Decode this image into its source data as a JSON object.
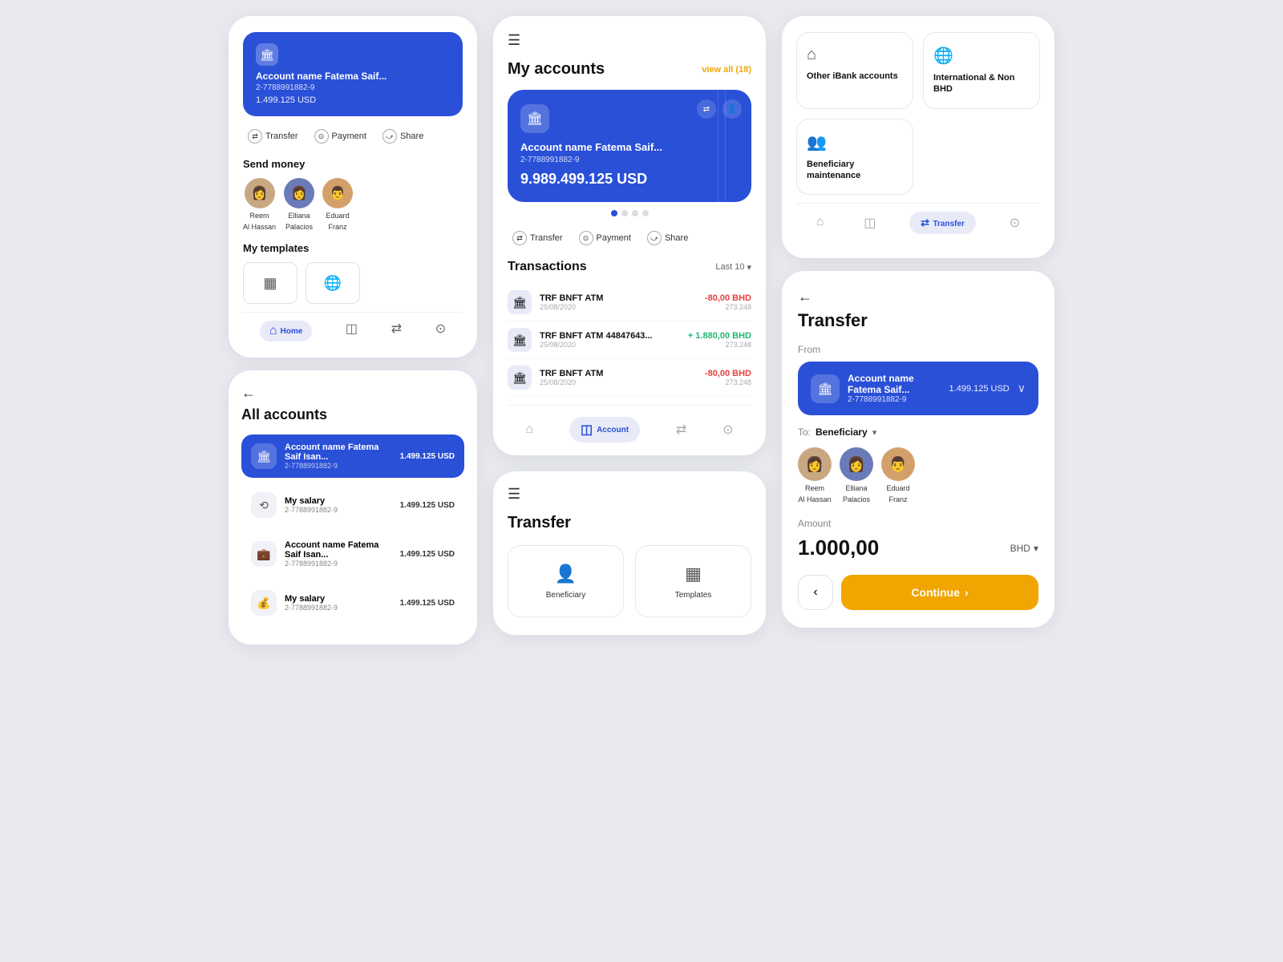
{
  "col1": {
    "top_card": {
      "account_name": "Account name Fatema Saif...",
      "account_number": "2-7788991882-9",
      "balance": "1.499.125 USD"
    },
    "actions": [
      {
        "label": "Transfer",
        "icon": "⇄"
      },
      {
        "label": "Payment",
        "icon": "⊙"
      },
      {
        "label": "Share",
        "icon": "⤻"
      }
    ],
    "send_money_title": "Send money",
    "contacts": [
      {
        "name": "Reem Al Hassan",
        "emoji": "👩"
      },
      {
        "name": "Elliana Palacios",
        "emoji": "👩"
      },
      {
        "name": "Eduard Franz",
        "emoji": "👨"
      }
    ],
    "templates_title": "My templates",
    "templates": [
      "▦",
      "🌐"
    ],
    "nav": [
      {
        "label": "Home",
        "icon": "⌂",
        "active": true
      },
      {
        "label": "",
        "icon": "◫",
        "active": false
      },
      {
        "label": "",
        "icon": "⇄",
        "active": false
      },
      {
        "label": "",
        "icon": "⊙",
        "active": false
      }
    ]
  },
  "col1_bottom": {
    "back_label": "←",
    "title": "All accounts",
    "accounts": [
      {
        "name": "Account name Fatema Saif Isan...",
        "number": "2-7788991882-9",
        "balance": "1.499.125 USD",
        "icon": "🏛",
        "highlighted": true
      },
      {
        "name": "My salary",
        "number": "2-7788991882-9",
        "balance": "1.499.125 USD",
        "icon": "⟲",
        "highlighted": false
      },
      {
        "name": "Account name Fatema Saif Isan...",
        "number": "2-7788991882-9",
        "balance": "1.499.125 USD",
        "icon": "💼",
        "highlighted": false
      },
      {
        "name": "My salary",
        "number": "2-7788991882-9",
        "balance": "1.499.125 USD",
        "icon": "💰",
        "highlighted": false
      }
    ]
  },
  "col2_main": {
    "menu_icon": "☰",
    "title": "My accounts",
    "view_all": "view all (18)",
    "account": {
      "name": "Account name Fatema Saif...",
      "number": "2-7788991882-9",
      "balance": "9.989.499.125 USD"
    },
    "dots": [
      true,
      false,
      false,
      false
    ],
    "action_buttons": [
      {
        "label": "Transfer",
        "icon": "⇄"
      },
      {
        "label": "Payment",
        "icon": "⊙"
      },
      {
        "label": "Share",
        "icon": "⤻"
      }
    ],
    "transactions_title": "Transactions",
    "last_n": "Last 10",
    "transactions": [
      {
        "name": "TRF BNFT ATM",
        "date": "25/08/2020",
        "amount": "-80,00 BHD",
        "balance": "273.248",
        "positive": false
      },
      {
        "name": "TRF BNFT ATM 44847643...",
        "date": "25/08/2020",
        "amount": "+ 1.880,00 BHD",
        "balance": "273.248",
        "positive": true
      },
      {
        "name": "TRF BNFT ATM",
        "date": "25/08/2020",
        "amount": "-80,00 BHD",
        "balance": "273.248",
        "positive": false
      }
    ],
    "nav": [
      {
        "label": "",
        "icon": "⌂",
        "active": false
      },
      {
        "label": "Account",
        "icon": "◫",
        "active": true
      },
      {
        "label": "",
        "icon": "⇄",
        "active": false
      },
      {
        "label": "",
        "icon": "⊙",
        "active": false
      }
    ]
  },
  "col2_bottom": {
    "menu_icon": "☰",
    "title": "Transfer",
    "options": [
      {
        "icon": "👤",
        "label": "Beneficiary"
      },
      {
        "icon": "▦",
        "label": "Templates"
      }
    ]
  },
  "col3_top": {
    "quick_actions": [
      {
        "icon": "⌂",
        "label": "Other iBank accounts"
      },
      {
        "icon": "🌐",
        "label": "International & Non BHD"
      },
      {
        "icon": "👥",
        "label": "Beneficiary maintenance"
      }
    ],
    "nav": [
      {
        "icon": "⌂",
        "active": false
      },
      {
        "icon": "◫",
        "active": false
      },
      {
        "icon": "⇄",
        "active": true,
        "label": "Transfer"
      },
      {
        "icon": "⊙",
        "active": false
      }
    ]
  },
  "col3_bottom": {
    "back_label": "←",
    "title": "Transfer",
    "from_label": "From",
    "account": {
      "name": "Account name Fatema Saif...",
      "number": "2-7788991882-9",
      "balance": "1.499.125 USD"
    },
    "to_label": "To:",
    "to_value": "Beneficiary",
    "beneficiaries": [
      {
        "name": "Reem Al Hassan",
        "emoji": "👩"
      },
      {
        "name": "Elliana Palacios",
        "emoji": "👩"
      },
      {
        "name": "Eduard Franz",
        "emoji": "👨"
      }
    ],
    "amount_label": "Amount",
    "amount_value": "1.000,00",
    "currency": "BHD",
    "back_btn": "‹",
    "continue_btn": "Continue",
    "continue_arrow": "›"
  }
}
